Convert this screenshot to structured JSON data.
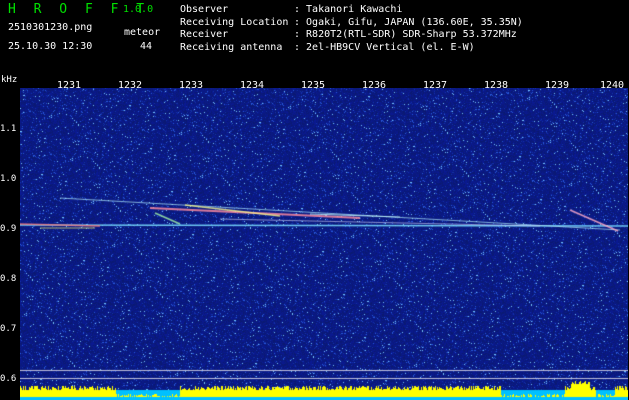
{
  "app": {
    "title": "H R O F F T",
    "version": "1.0.0"
  },
  "file": {
    "name": "2510301230.png",
    "timestamp": "25.10.30 12:30"
  },
  "meteor": {
    "label": "meteor",
    "count": "44"
  },
  "info": [
    {
      "key": "Observer",
      "value": ": Takanori Kawachi"
    },
    {
      "key": "Receiving Location",
      "value": ": Ogaki, Gifu, JAPAN (136.60E, 35.35N)"
    },
    {
      "key": "Receiver",
      "value": ": R820T2(RTL-SDR) SDR-Sharp 53.372MHz"
    },
    {
      "key": "Receiving antenna",
      "value": ": 2el-HB9CV Vertical (el. E-W)"
    }
  ],
  "axis": {
    "unit": "kHz",
    "x_ticks": [
      "1231",
      "1232",
      "1233",
      "1234",
      "1235",
      "1236",
      "1237",
      "1238",
      "1239",
      "1240"
    ],
    "y_ticks": [
      "1.1",
      "1.0",
      "0.9",
      "0.8",
      "0.7",
      "0.6"
    ]
  },
  "colors": {
    "title": "#00e000",
    "background": "#000000",
    "noise": "#1a2a9a",
    "level_bar": "#ffff00",
    "base_bar": "#00c0ff"
  }
}
